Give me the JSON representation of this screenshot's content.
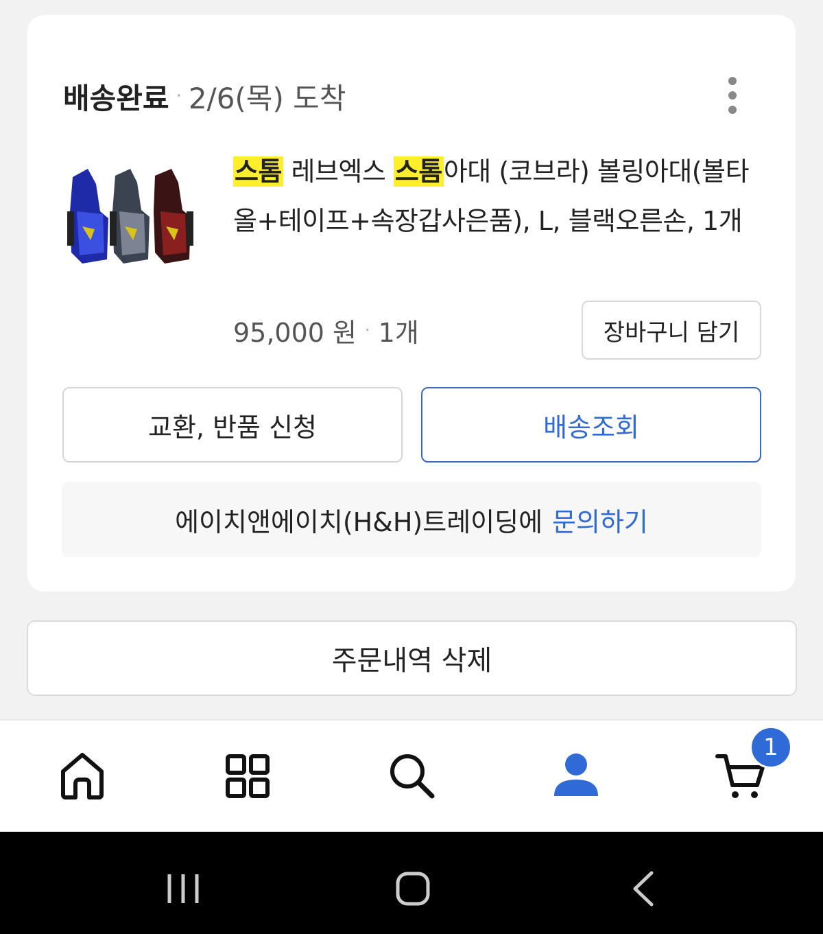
{
  "order": {
    "status": "배송완료",
    "separator": "·",
    "arrival": "2/6(목) 도착",
    "more_icon": "more-vertical-icon"
  },
  "product": {
    "image": "bowling-wrist-support-thumbnail",
    "title_parts": {
      "hl1": "스톰",
      "t1": " 레브엑스 ",
      "hl2": "스톰",
      "t2": "아대 (코브라) 볼링아대(볼타올+테이프+속장갑사은품), L, 블랙오른손, 1개"
    },
    "price": "95,000 원",
    "separator": "·",
    "quantity": "1개",
    "cart_button": "장바구니 담기"
  },
  "actions": {
    "return_label": "교환, 반품 신청",
    "track_label": "배송조회"
  },
  "inquiry": {
    "seller_text": "에이치앤에이치(H&H)트레이딩에",
    "link_text": "문의하기"
  },
  "delete_label": "주문내역 삭제",
  "nav": {
    "items": [
      "home-icon",
      "category-grid-icon",
      "search-icon",
      "my-page-person-icon",
      "cart-icon"
    ],
    "active": "my-page-person-icon",
    "cart_badge": "1",
    "accent": "#2f6ad6"
  },
  "system_nav": [
    "recent-apps-icon",
    "home-button-icon",
    "back-icon"
  ]
}
